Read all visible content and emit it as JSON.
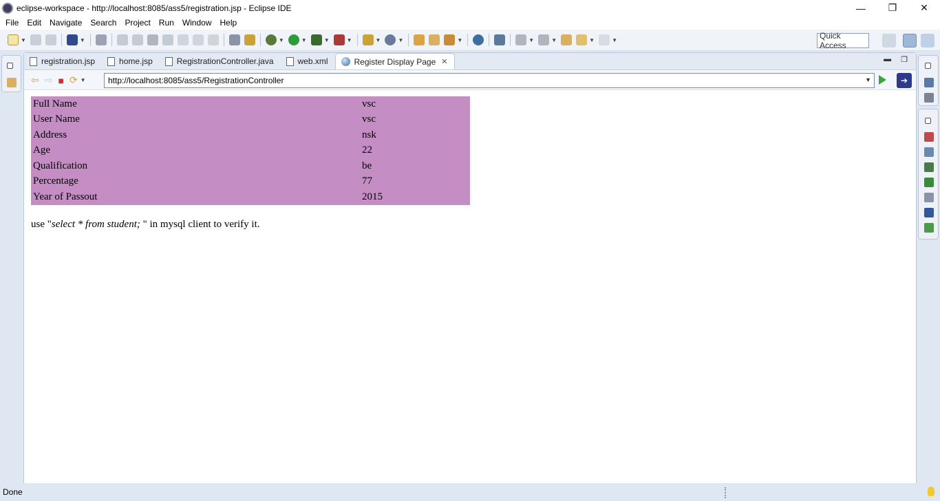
{
  "window": {
    "title": "eclipse-workspace - http://localhost:8085/ass5/registration.jsp - Eclipse IDE",
    "minimize": "—",
    "maximize": "❐",
    "close": "✕"
  },
  "menu": [
    "File",
    "Edit",
    "Navigate",
    "Search",
    "Project",
    "Run",
    "Window",
    "Help"
  ],
  "toolbar": {
    "quick_access": "Quick Access"
  },
  "tabs": [
    {
      "label": "registration.jsp",
      "icon": "jsp-file-icon"
    },
    {
      "label": "home.jsp",
      "icon": "jsp-file-icon"
    },
    {
      "label": "RegistrationController.java",
      "icon": "java-file-icon"
    },
    {
      "label": "web.xml",
      "icon": "xml-file-icon"
    },
    {
      "label": "Register Display Page",
      "icon": "globe-icon",
      "active": true
    }
  ],
  "browser": {
    "url": "http://localhost:8085/ass5/RegistrationController"
  },
  "registration": {
    "rows": [
      {
        "label": "Full Name",
        "value": "vsc"
      },
      {
        "label": "User Name",
        "value": "vsc"
      },
      {
        "label": "Address",
        "value": "nsk"
      },
      {
        "label": "Age",
        "value": "22"
      },
      {
        "label": "Qualification",
        "value": "be"
      },
      {
        "label": "Percentage",
        "value": "77"
      },
      {
        "label": "Year of Passout",
        "value": "2015"
      }
    ],
    "row_color": "#c48dc4"
  },
  "hint": {
    "prefix": "use \"",
    "query": "select * from student;",
    "suffix": "\" in mysql client to verify it."
  },
  "status": {
    "text": "Done"
  }
}
